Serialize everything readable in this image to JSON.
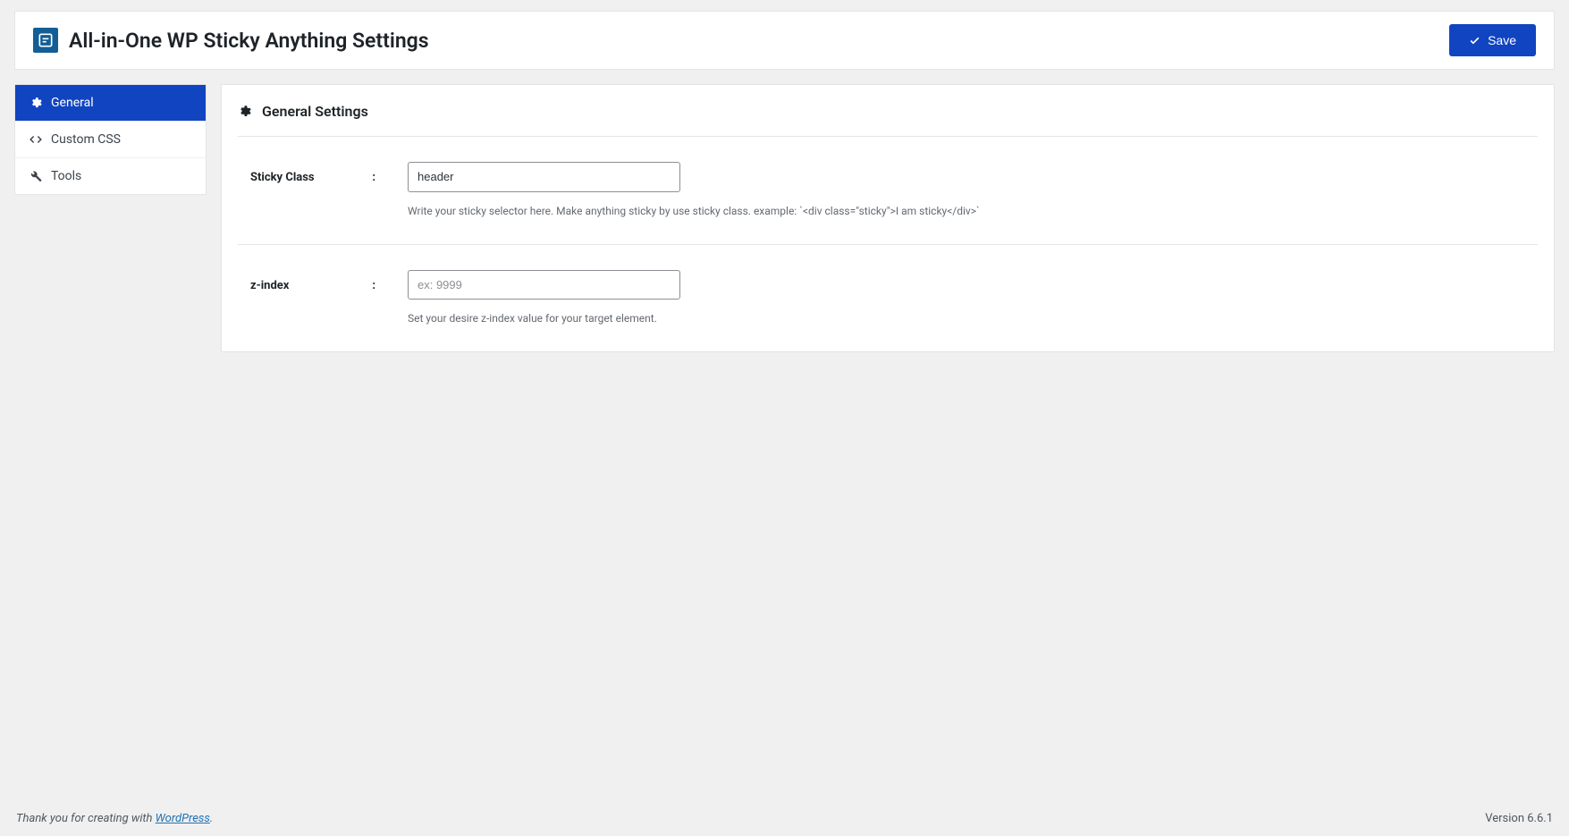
{
  "header": {
    "title": "All-in-One WP Sticky Anything Settings",
    "save_label": "Save"
  },
  "sidebar": {
    "items": [
      {
        "label": "General",
        "icon": "gear"
      },
      {
        "label": "Custom CSS",
        "icon": "code"
      },
      {
        "label": "Tools",
        "icon": "wrench"
      }
    ]
  },
  "panel": {
    "title": "General Settings",
    "fields": {
      "sticky_class": {
        "label": "Sticky Class",
        "value": "header",
        "help": "Write your sticky selector here. Make anything sticky by use sticky class. example: `<div class=\"sticky\">I am sticky</div>`"
      },
      "z_index": {
        "label": "z-index",
        "placeholder": "ex: 9999",
        "value": "",
        "help": "Set your desire z-index value for your target element."
      }
    }
  },
  "footer": {
    "thanks_prefix": "Thank you for creating with ",
    "thanks_link_text": "WordPress",
    "thanks_suffix": ".",
    "version_label": "Version 6.6.1"
  }
}
